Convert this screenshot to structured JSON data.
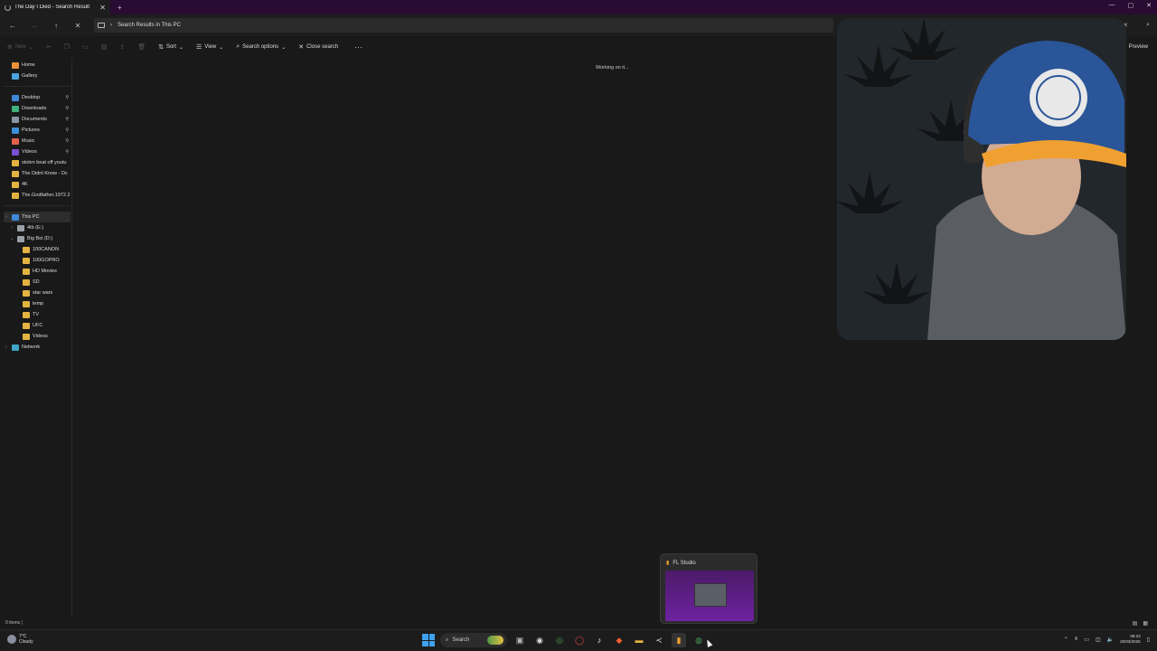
{
  "window": {
    "tab_title": "The Day I Died - Search Result",
    "new_tab": "+",
    "tab_close": "✕",
    "controls": [
      "—",
      "▢",
      "✕"
    ]
  },
  "address": {
    "location": "Search Results in This PC"
  },
  "toolbar": {
    "new_label": "New",
    "sort_label": "Sort",
    "view_label": "View",
    "search_options_label": "Search options",
    "close_search_label": "Close search",
    "more_label": "···",
    "preview_label": "Preview"
  },
  "sidebar": {
    "quick": [
      {
        "label": "Home",
        "color": "#e8913a"
      },
      {
        "label": "Gallery",
        "color": "#4aa3df"
      }
    ],
    "pinned": [
      {
        "label": "Desktop",
        "color": "#3f87d6",
        "pin": "📌"
      },
      {
        "label": "Downloads",
        "color": "#3fb07a",
        "pin": "📌"
      },
      {
        "label": "Documents",
        "color": "#8a94a6",
        "pin": "📌"
      },
      {
        "label": "Pictures",
        "color": "#3a8fd8",
        "pin": "📌"
      },
      {
        "label": "Music",
        "color": "#e0604c",
        "pin": "📌"
      },
      {
        "label": "Videos",
        "color": "#7b4fd1",
        "pin": "📌"
      },
      {
        "label": "stolen beat off youtu",
        "color": "#e3b341",
        "pin": ""
      },
      {
        "label": "The Didnt Know - Dc",
        "color": "#e3b341",
        "pin": ""
      },
      {
        "label": "4K",
        "color": "#e3b341",
        "pin": ""
      },
      {
        "label": "The.Godfather.1972.2",
        "color": "#e3b341",
        "pin": ""
      }
    ],
    "drives": [
      {
        "label": "This PC",
        "color": "#3f87d6",
        "indent": 0,
        "selected": true
      },
      {
        "label": "4tb (E:)",
        "color": "#9aa0a8",
        "indent": 1
      },
      {
        "label": "Big Boi (D:)",
        "color": "#9aa0a8",
        "indent": 1,
        "expanded": true
      },
      {
        "label": "100CANON",
        "color": "#e3b341",
        "indent": 2
      },
      {
        "label": "100GOPRO",
        "color": "#e3b341",
        "indent": 2
      },
      {
        "label": "HD Movies",
        "color": "#e3b341",
        "indent": 2
      },
      {
        "label": "SD",
        "color": "#e3b341",
        "indent": 2
      },
      {
        "label": "star wars",
        "color": "#e3b341",
        "indent": 2
      },
      {
        "label": "temp",
        "color": "#e3b341",
        "indent": 2
      },
      {
        "label": "TV",
        "color": "#e3b341",
        "indent": 2
      },
      {
        "label": "UFC",
        "color": "#e3b341",
        "indent": 2
      },
      {
        "label": "Videos",
        "color": "#e3b341",
        "indent": 2
      },
      {
        "label": "Network",
        "color": "#3fa6c8",
        "indent": 0
      }
    ]
  },
  "main": {
    "working_text": "Working on it..."
  },
  "status": {
    "items_count": "0 items",
    "separator": "|"
  },
  "preview_thumbnail": {
    "title": "FL Studio"
  },
  "taskbar": {
    "weather_temp": "7°C",
    "weather_desc": "Cloudy",
    "search_label": "Search",
    "time": "08:23",
    "date": "20/03/2026"
  }
}
